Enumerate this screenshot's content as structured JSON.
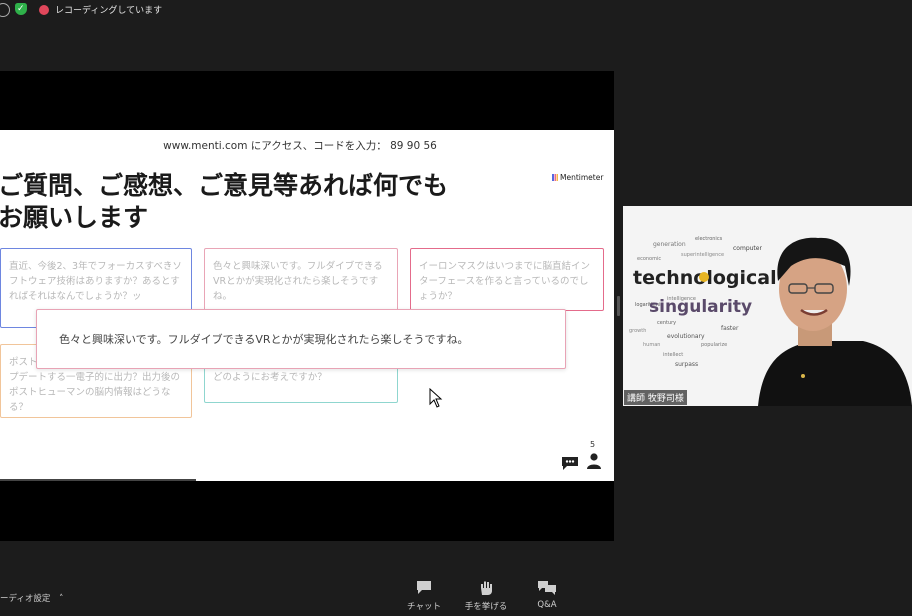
{
  "topbar": {
    "recording_text": "レコーディングしています",
    "info_icon": "info-icon",
    "shield_icon": "shield-check-icon",
    "record_icon": "record-icon"
  },
  "slide": {
    "join_prefix": "www.menti.com",
    "join_middle": " にアクセス、コードを入力： ",
    "join_code": "89 90 56",
    "brand": "Mentimeter",
    "title_line1": "ご質問、ご感想、ご意見等あれば何でも",
    "title_line2": "お願いします",
    "participants_count": "5",
    "cards": [
      {
        "text": "直近、今後2、3年でフォーカスすべきソフトウェア技術はありますか？あるとすればそれはなんでしょうか？ッ"
      },
      {
        "text": "色々と興味深いです。フルダイブできるVRとかが実現化されたら楽しそうですね。"
      },
      {
        "text": "イーロンマスクはいつまでに脳直結インターフェースを作ると言っているのでしょうか？"
      },
      {
        "text": "ポストヒューマンへ、ビューータにアップデートする一電子的に出力？出力後のポストヒューマンの脳内情報はどうなる？"
      },
      {
        "text": "生物・全感染との共存？ 対立について、どのようにお考えですか？"
      }
    ],
    "popup_text": "色々と興味深いです。フルダイブできるVRとかが実現化されたら楽しそうですね。"
  },
  "speaker": {
    "name_label": "講師 牧野司様",
    "wordcloud": {
      "title1": "technological",
      "title2": "singularity"
    }
  },
  "bottom": {
    "audio_settings": "ーディオ設定",
    "buttons": [
      {
        "label": "チャット",
        "icon": "chat-icon"
      },
      {
        "label": "手を挙げる",
        "icon": "raise-hand-icon"
      },
      {
        "label": "Q&A",
        "icon": "qa-icon"
      }
    ]
  },
  "colors": {
    "background": "#1c1c1c",
    "recording_red": "#e0475b",
    "shield_green": "#2fb14a",
    "card_blue": "#6e86e0",
    "card_pink": "#e46b8b",
    "card_orange": "#f1c59a",
    "card_teal": "#8fd6cf"
  }
}
